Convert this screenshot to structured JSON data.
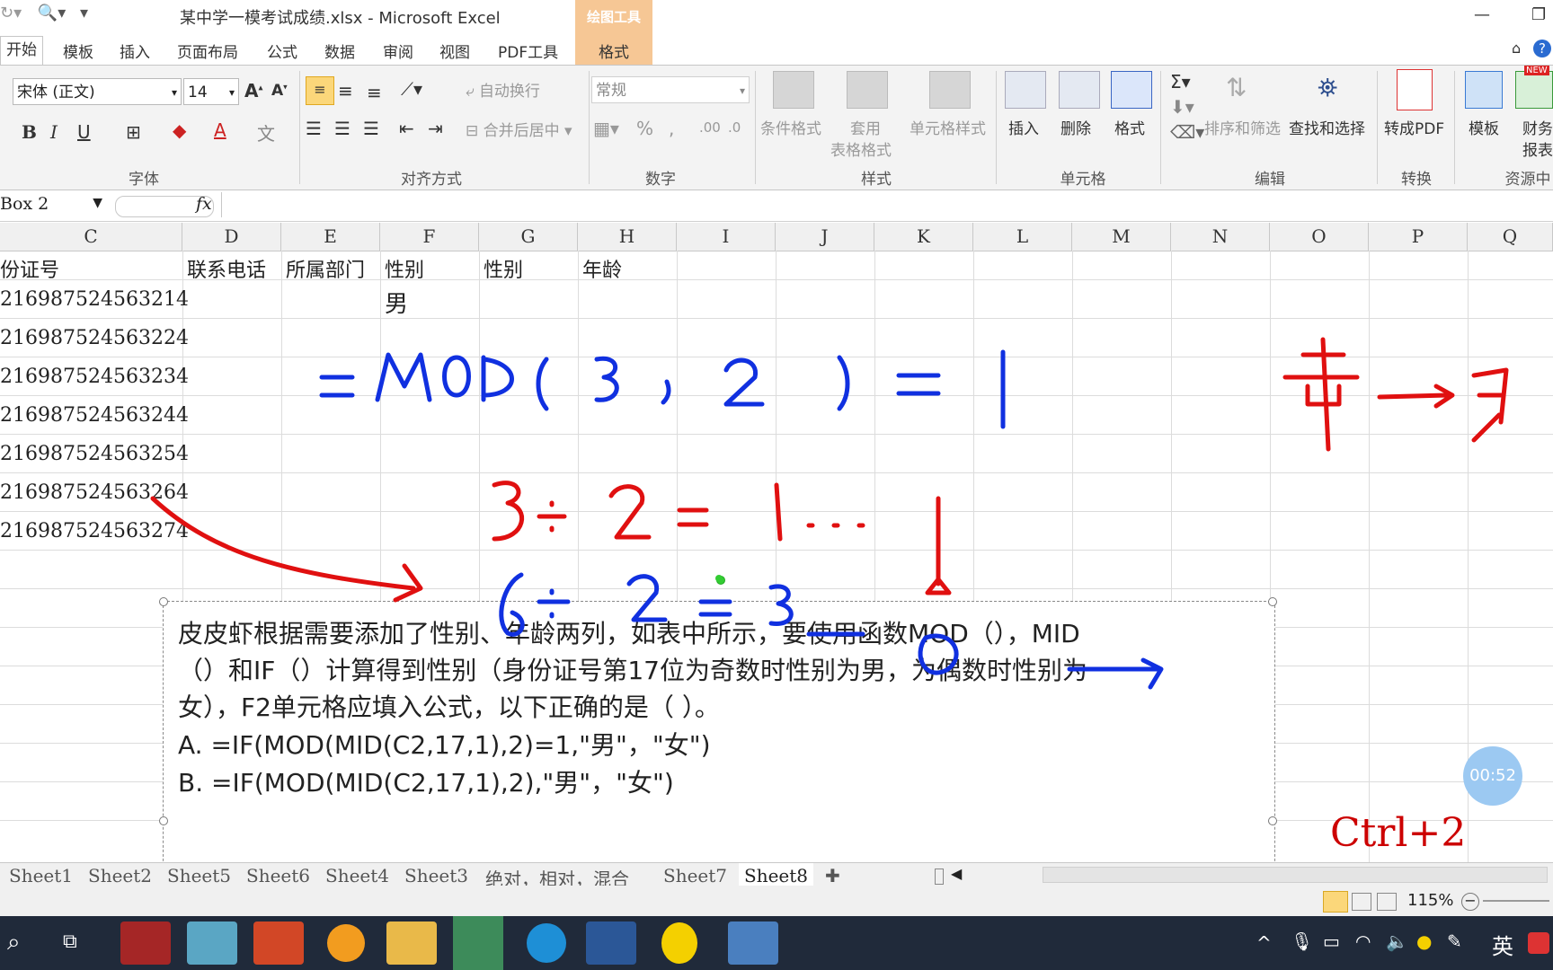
{
  "window": {
    "title": "某中学一模考试成绩.xlsx - Microsoft Excel",
    "context_tool_header": "绘图工具",
    "context_tool_tab": "格式"
  },
  "tabs": [
    "开始",
    "模板",
    "插入",
    "页面布局",
    "公式",
    "数据",
    "审阅",
    "视图",
    "PDF工具"
  ],
  "ribbon": {
    "font_name": "宋体 (正文)",
    "font_size": "14",
    "number_format": "常规",
    "wrap_text": "自动换行",
    "merge_center": "合并后居中",
    "conditional_format": "条件格式",
    "table_format_1": "套用",
    "table_format_2": "表格格式",
    "cell_style": "单元格样式",
    "insert": "插入",
    "delete": "删除",
    "format": "格式",
    "sort_filter": "排序和筛选",
    "find_select": "查找和选择",
    "to_pdf": "转成PDF",
    "template": "模板",
    "finance_1": "财务",
    "finance_2": "报表",
    "new_badge": "NEW",
    "groups": {
      "font": "字体",
      "alignment": "对齐方式",
      "number": "数字",
      "styles": "样式",
      "cells": "单元格",
      "editing": "编辑",
      "convert": "转换",
      "resources": "资源中"
    }
  },
  "formula_bar": {
    "name_box": "Box 2",
    "fx": "fx",
    "value": ""
  },
  "columns": [
    "C",
    "D",
    "E",
    "F",
    "G",
    "H",
    "I",
    "J",
    "K",
    "L",
    "M",
    "N",
    "O",
    "P",
    "Q"
  ],
  "header_row": {
    "C": "份证号",
    "D": "联系电话",
    "E": "所属部门",
    "F": "性别",
    "G": "性别",
    "H": "年龄"
  },
  "id_numbers": [
    "216987524563214",
    "216987524563224",
    "216987524563234",
    "216987524563244",
    "216987524563254",
    "216987524563264",
    "216987524563274"
  ],
  "f2_value": "男",
  "textbox": {
    "line1": "皮皮虾根据需要添加了性别、年龄两列，如表中所示，要使用函数MOD（），MID",
    "line2": "（）和IF（）计算得到性别（身份证号第17位为奇数时性别为男，为偶数时性别为",
    "line3": "女），F2单元格应填入公式，以下正确的是（          ）。",
    "option_a": "A. =IF(MOD(MID(C2,17,1),2)=1,\"男\"，\"女\")",
    "option_b": "B. =IF(MOD(MID(C2,17,1),2),\"男\"，\"女\")"
  },
  "sheet_tabs": [
    "Sheet1",
    "Sheet2",
    "Sheet5",
    "Sheet6",
    "Sheet4",
    "Sheet3",
    "绝对，相对，混合",
    "Sheet7",
    "Sheet8"
  ],
  "status": {
    "zoom": "115%"
  },
  "overlay": {
    "timer": "00:52",
    "shortcut": "Ctrl+2"
  },
  "taskbar": {
    "ime": "英"
  },
  "colors": {
    "accent_orange": "#f6c795",
    "ink_blue": "#1030e0",
    "ink_red": "#e01010",
    "taskbar": "#202a3a"
  }
}
